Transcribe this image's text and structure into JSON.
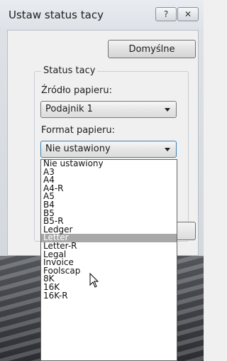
{
  "window": {
    "title": "Ustaw status tacy",
    "help_label": "?",
    "close_label": "✕"
  },
  "buttons": {
    "default_label": "Domyślne"
  },
  "group": {
    "title": "Status tacy",
    "source_label": "Źródło papieru:",
    "source_value": "Podajnik 1",
    "format_label": "Format papieru:",
    "format_value": "Nie ustawiony"
  },
  "dropdown": {
    "options": [
      "Nie ustawiony",
      "A3",
      "A4",
      "A4-R",
      "A5",
      "B4",
      "B5",
      "B5-R",
      "Ledger",
      "Letter",
      "Letter-R",
      "Legal",
      "Invoice",
      "Foolscap",
      "8K",
      "16K",
      "16K-R"
    ],
    "hovered": "Letter"
  },
  "icons": {
    "cursor": "mouse-pointer-icon"
  }
}
